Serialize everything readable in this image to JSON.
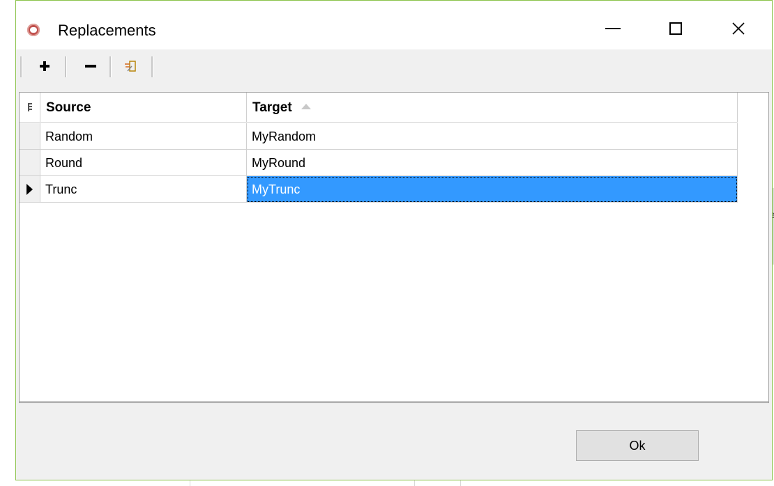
{
  "window": {
    "title": "Replacements",
    "app_icon": "cx-app-icon",
    "controls": {
      "minimize_icon": "minimize-icon",
      "maximize_icon": "maximize-icon",
      "close_icon": "close-icon"
    }
  },
  "toolbar": {
    "items": [
      {
        "name": "add-row-button",
        "icon": "plus-icon"
      },
      {
        "name": "remove-row-button",
        "icon": "minus-icon"
      },
      {
        "name": "edit-row-button",
        "icon": "edit-icon"
      }
    ]
  },
  "grid": {
    "columns": [
      {
        "label": "Source"
      },
      {
        "label": "Target",
        "sort": "ascending"
      }
    ],
    "rows": [
      {
        "source": "Random",
        "target": "MyRandom",
        "current": false
      },
      {
        "source": "Round",
        "target": "MyRound",
        "current": false
      },
      {
        "source": "Trunc",
        "target": "MyTrunc",
        "current": true,
        "selected_column": "target"
      }
    ]
  },
  "footer": {
    "ok_label": "Ok"
  },
  "colors": {
    "selection": "#3399ff",
    "window_border": "#8bc34a",
    "dialog_bg": "#f0f0f0"
  }
}
